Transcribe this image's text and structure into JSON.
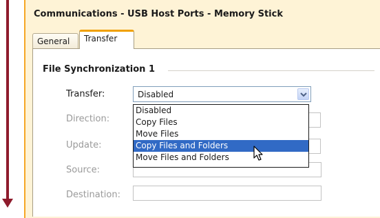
{
  "window": {
    "title": "Communications - USB Host Ports - Memory Stick"
  },
  "tabs": [
    {
      "label": "General",
      "active": false
    },
    {
      "label": "Transfer",
      "active": true
    }
  ],
  "group": {
    "title": "File Synchronization 1"
  },
  "form": {
    "transfer_label": "Transfer:",
    "transfer_value": "Disabled",
    "direction_label": "Direction:",
    "update_label": "Update:",
    "source_label": "Source:",
    "destination_label": "Destination:"
  },
  "dropdown": {
    "options": [
      "Disabled",
      "Copy Files",
      "Move Files",
      "Copy Files and Folders",
      "Move Files and Folders"
    ],
    "highlighted_index": 3
  },
  "colors": {
    "arrow": "#8e1b2c",
    "frame_accent": "#f5a623",
    "highlight": "#316ac5"
  },
  "icons": {
    "combo_button": "chevron-down-icon",
    "cursor": "mouse-pointer-icon",
    "annotation": "down-arrow-icon"
  }
}
